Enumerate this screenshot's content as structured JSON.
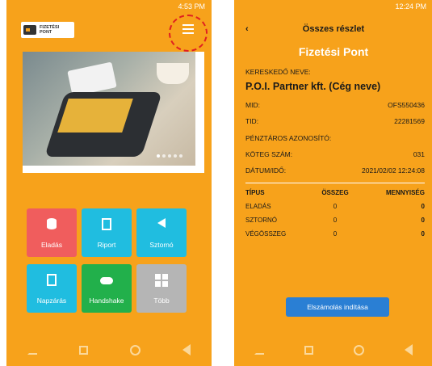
{
  "left": {
    "status": "4:53 PM",
    "logo": {
      "line1": "FIZETÉSI",
      "line2": "PONT"
    },
    "tiles": [
      {
        "label": "Eladás",
        "color": "#f05d5d",
        "icon": "database-icon"
      },
      {
        "label": "Riport",
        "color": "#20bde0",
        "icon": "document-icon"
      },
      {
        "label": "Sztornó",
        "color": "#20bde0",
        "icon": "undo-icon"
      },
      {
        "label": "Napzárás",
        "color": "#20bde0",
        "icon": "report-edit-icon"
      },
      {
        "label": "Handshake",
        "color": "#22b04b",
        "icon": "cloud-icon"
      },
      {
        "label": "Több",
        "color": "#b5b5b5",
        "icon": "grid-icon"
      }
    ]
  },
  "right": {
    "status": "12:24 PM",
    "back": "‹",
    "header": "Összes részlet",
    "subtitle": "Fizetési Pont",
    "merchant_label": "KERESKEDŐ NEVE:",
    "merchant_name": "P.O.I. Partner kft. (Cég neve)",
    "mid_label": "MID:",
    "mid_value": "OFS550436",
    "tid_label": "TID:",
    "tid_value": "22281569",
    "cashier_label": "PÉNZTÁROS AZONOSÍTÓ:",
    "batch_label": "KÖTEG SZÁM:",
    "batch_value": "031",
    "datetime_label": "DÁTUM/IDŐ:",
    "datetime_value": "2021/02/02 12:24:08",
    "table": {
      "headers": [
        "TÍPUS",
        "ÖSSZEG",
        "MENNYISÉG"
      ],
      "rows": [
        [
          "ELADÁS",
          "0",
          "0"
        ],
        [
          "SZTORNÓ",
          "0",
          "0"
        ],
        [
          "VÉGÖSSZEG",
          "0",
          "0"
        ]
      ]
    },
    "button": "Elszámolás indítása"
  },
  "colors": {
    "accent": "#f7a21b",
    "button": "#2a7fd4"
  }
}
